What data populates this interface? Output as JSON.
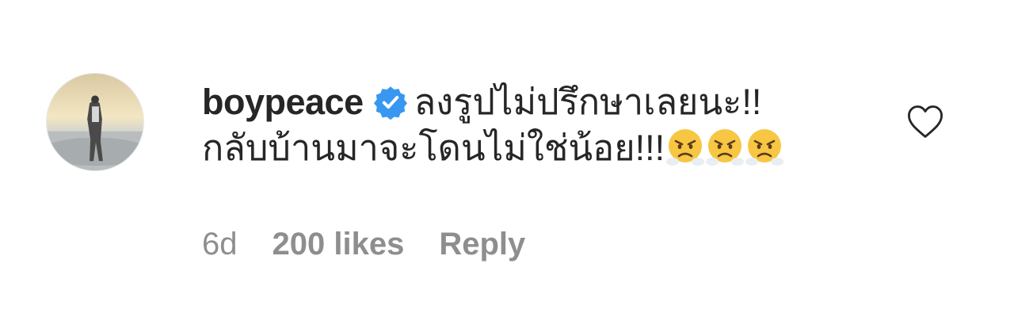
{
  "comment": {
    "username": "boypeace",
    "verified_icon": "verified-badge-icon",
    "text_line1": "ลงรูปไม่ปรึกษาเลยนะ!!",
    "text_line2": "กลับบ้านมาจะโดนไม่ใช่น้อย!!!",
    "emojis": [
      "face-with-steam-from-nose",
      "face-with-steam-from-nose",
      "face-with-steam-from-nose"
    ],
    "time": "6d",
    "likes": "200 likes",
    "reply": "Reply",
    "like_icon": "heart-outline-icon"
  },
  "colors": {
    "text": "#262626",
    "meta": "#8e8e8e",
    "verified": "#3897f0",
    "emoji": "#f7c744"
  }
}
